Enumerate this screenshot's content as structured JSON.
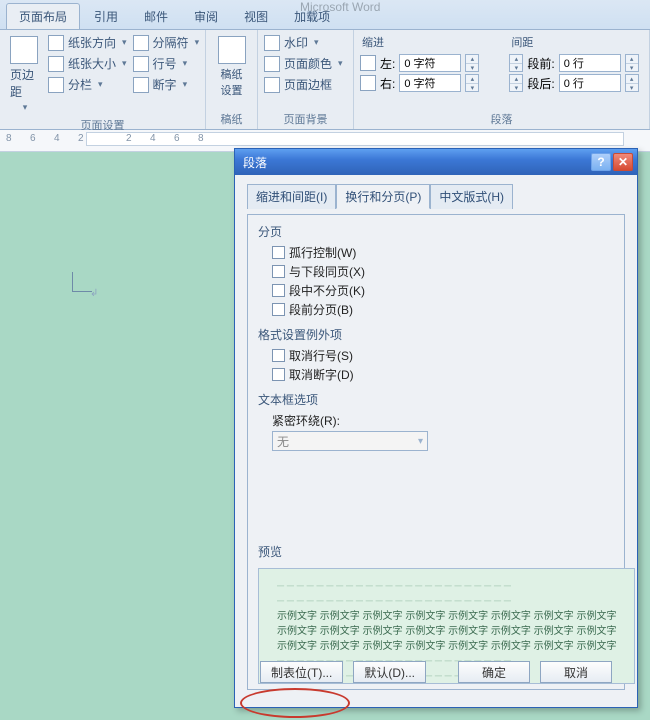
{
  "app_title": "Microsoft Word",
  "ribbon_tabs": [
    "页面布局",
    "引用",
    "邮件",
    "审阅",
    "视图",
    "加载项"
  ],
  "active_ribbon_tab": 0,
  "ribbon": {
    "page_setup": {
      "label": "页面设置",
      "margins": "页边距",
      "orientation": "纸张方向",
      "size": "纸张大小",
      "columns": "分栏",
      "breaks": "分隔符",
      "line_numbers": "行号",
      "hyphenation": "断字"
    },
    "manuscript": {
      "label": "稿纸",
      "btn": "稿纸设置"
    },
    "page_bg": {
      "label": "页面背景",
      "watermark": "水印",
      "page_color": "页面颜色",
      "page_borders": "页面边框"
    },
    "paragraph": {
      "label": "段落",
      "indent_title": "缩进",
      "indent_left_label": "左:",
      "indent_left_value": "0 字符",
      "indent_right_label": "右:",
      "indent_right_value": "0 字符",
      "spacing_title": "间距",
      "spacing_before_label": "段前:",
      "spacing_before_value": "0 行",
      "spacing_after_label": "段后:",
      "spacing_after_value": "0 行"
    }
  },
  "ruler_ticks": [
    "8",
    "6",
    "4",
    "2",
    "2",
    "4",
    "6",
    "8"
  ],
  "dialog": {
    "title": "段落",
    "tabs": [
      "缩进和间距(I)",
      "换行和分页(P)",
      "中文版式(H)"
    ],
    "active_tab": 1,
    "pagination": {
      "legend": "分页",
      "widow_control": "孤行控制(W)",
      "keep_with_next": "与下段同页(X)",
      "keep_lines_together": "段中不分页(K)",
      "page_break_before": "段前分页(B)"
    },
    "formatting_exceptions": {
      "legend": "格式设置例外项",
      "suppress_line_numbers": "取消行号(S)",
      "dont_hyphenate": "取消断字(D)"
    },
    "textbox_options": {
      "legend": "文本框选项",
      "tight_wrap_label": "紧密环绕(R):",
      "tight_wrap_value": "无"
    },
    "preview_legend": "预览",
    "preview_sample": "示例文字 示例文字 示例文字 示例文字 示例文字 示例文字 示例文字 示例文字",
    "buttons": {
      "tabs": "制表位(T)...",
      "default": "默认(D)...",
      "ok": "确定",
      "cancel": "取消"
    }
  }
}
